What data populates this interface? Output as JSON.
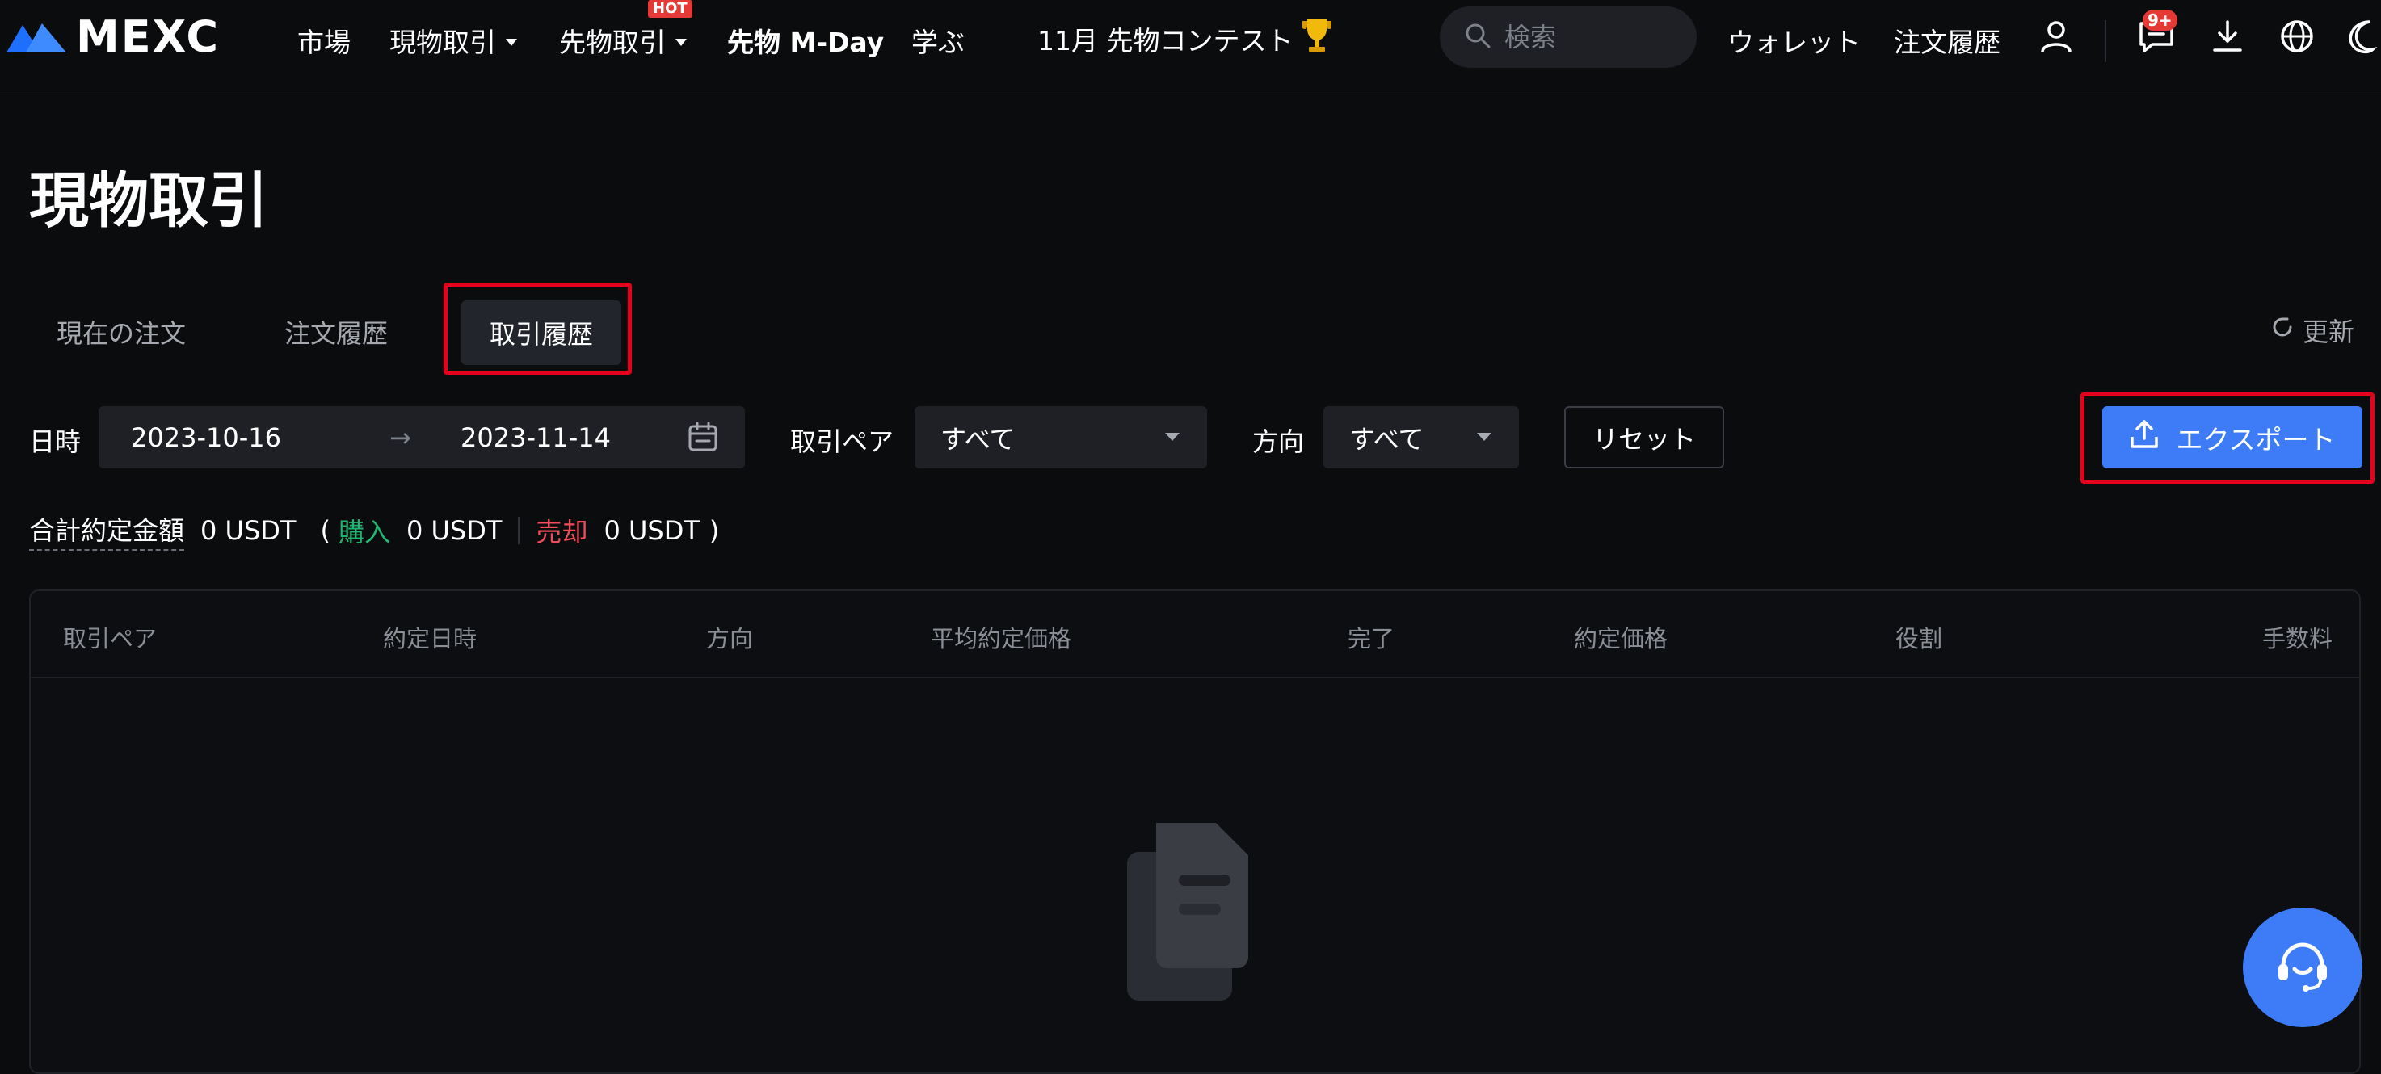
{
  "brand": {
    "name": "MEXC"
  },
  "nav": {
    "markets": "市場",
    "spot": "現物取引",
    "futures": "先物取引",
    "hot_badge": "HOT",
    "mday": "先物 M-Day",
    "learn": "学ぶ",
    "contest": "11月 先物コンテスト",
    "search_placeholder": "検索",
    "wallet": "ウォレット",
    "order_history": "注文履歴",
    "notif_count": "9+"
  },
  "page": {
    "title": "現物取引"
  },
  "tabs": {
    "current": "現在の注文",
    "history": "注文履歴",
    "trades": "取引履歴",
    "refresh": "更新"
  },
  "filters": {
    "date_label": "日時",
    "date_from": "2023-10-16",
    "date_to": "2023-11-14",
    "arrow": "→",
    "pair_label": "取引ペア",
    "pair_value": "すべて",
    "side_label": "方向",
    "side_value": "すべて",
    "reset": "リセット",
    "export": "エクスポート"
  },
  "summary": {
    "label": "合計約定金額",
    "total": "0 USDT",
    "open": "(",
    "buy_label": "購入",
    "buy_value": "0 USDT",
    "sell_label": "売却",
    "sell_value": "0 USDT",
    "close": ")"
  },
  "table": {
    "columns": [
      "取引ペア",
      "約定日時",
      "方向",
      "平均約定価格",
      "完了",
      "約定価格",
      "役割",
      "手数料"
    ]
  },
  "colors": {
    "accent": "#3d7cf6",
    "buy": "#22b673",
    "sell": "#f24c5c",
    "highlight": "#e5001e"
  }
}
